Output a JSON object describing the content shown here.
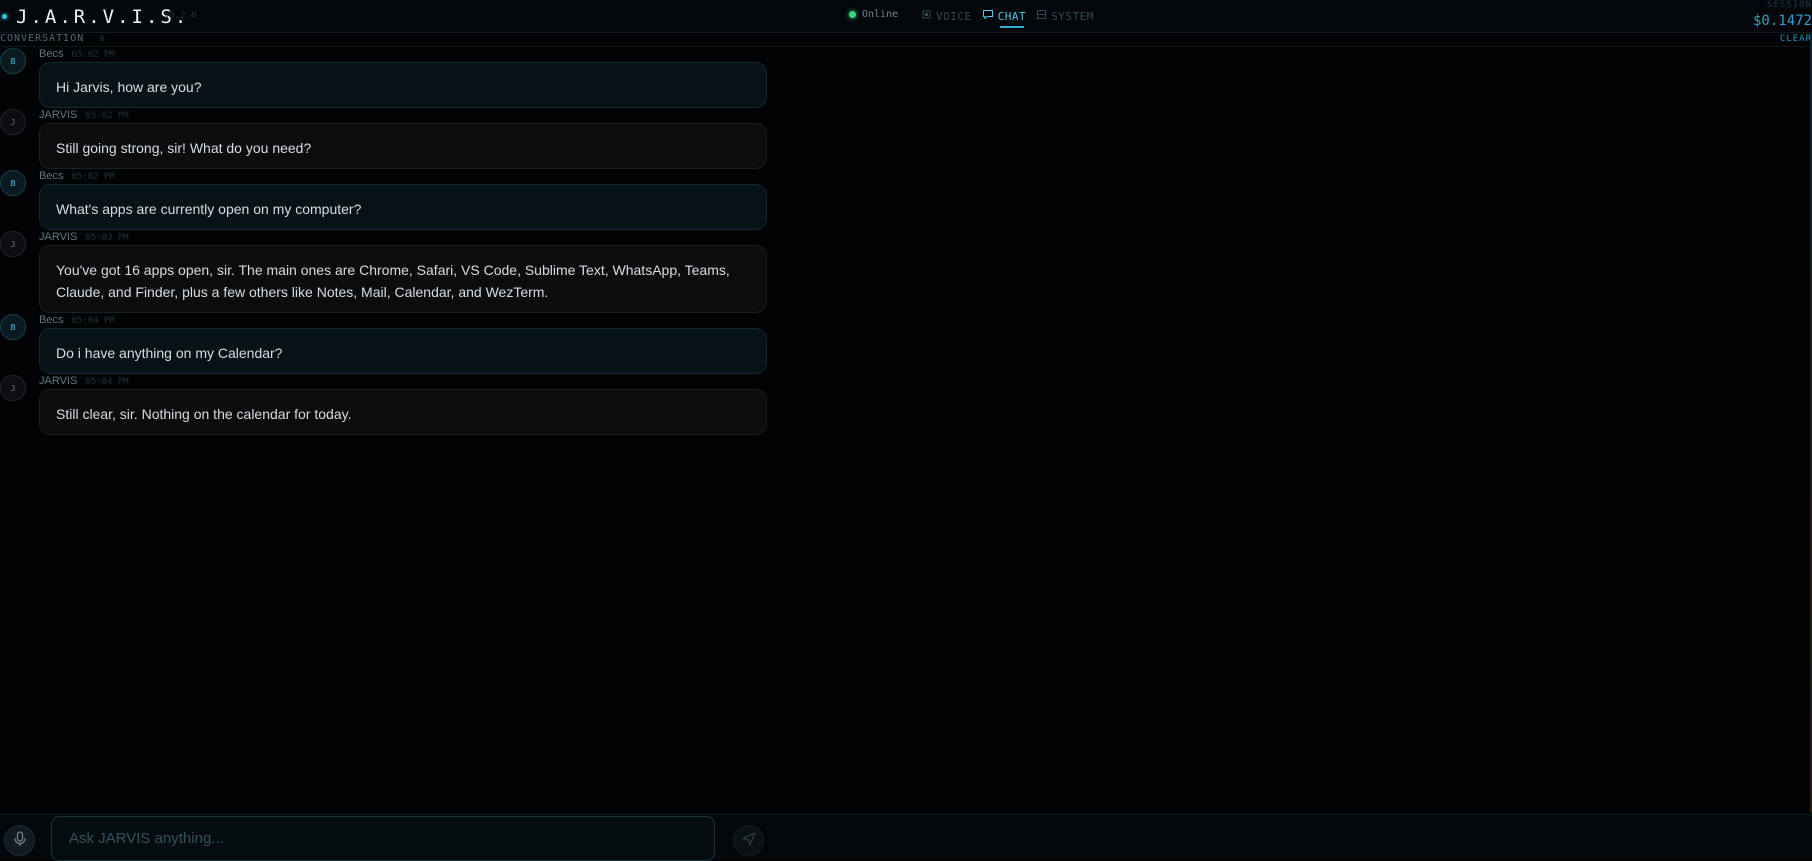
{
  "header": {
    "brand": "J.A.R.V.I.S.",
    "version": "v0.2.0",
    "status": "Online",
    "modes": [
      {
        "label": "VOICE",
        "icon": "cpu-icon",
        "active": false
      },
      {
        "label": "CHAT",
        "icon": "chat-bubble-icon",
        "active": true
      },
      {
        "label": "SYSTEM",
        "icon": "grid-icon",
        "active": false
      }
    ],
    "session_label": "SESSION",
    "session_cost": "$0.1472"
  },
  "conversation": {
    "title": "CONVERSATION",
    "count": "6",
    "clear_label": "CLEAR"
  },
  "messages": [
    {
      "role": "user",
      "initial": "B",
      "author": "Becs",
      "time": "05:02 PM",
      "text": "Hi Jarvis, how are you?"
    },
    {
      "role": "assistant",
      "initial": "J",
      "author": "JARVIS",
      "time": "05:02 PM",
      "text": "Still going strong, sir! What do you need?"
    },
    {
      "role": "user",
      "initial": "B",
      "author": "Becs",
      "time": "05:02 PM",
      "text": "What's apps are currently open on my computer?"
    },
    {
      "role": "assistant",
      "initial": "J",
      "author": "JARVIS",
      "time": "05:03 PM",
      "text": "You've got 16 apps open, sir. The main ones are Chrome, Safari, VS Code, Sublime Text, WhatsApp, Teams, Claude, and Finder, plus a few others like Notes, Mail, Calendar, and WezTerm."
    },
    {
      "role": "user",
      "initial": "B",
      "author": "Becs",
      "time": "05:04 PM",
      "text": "Do i have anything on my Calendar?"
    },
    {
      "role": "assistant",
      "initial": "J",
      "author": "JARVIS",
      "time": "05:04 PM",
      "text": "Still clear, sir. Nothing on the calendar for today."
    }
  ],
  "input": {
    "placeholder": "Ask JARVIS anything...",
    "value": ""
  },
  "colors": {
    "accent": "#2fc3ee",
    "online": "#36d67e",
    "background": "#020304"
  }
}
